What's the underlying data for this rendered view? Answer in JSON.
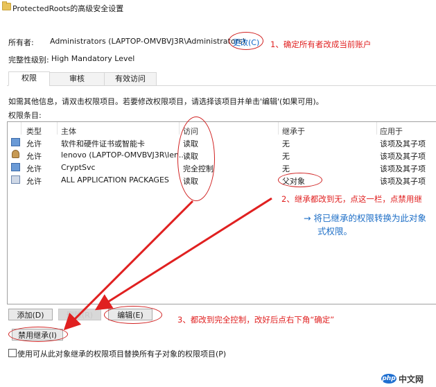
{
  "window": {
    "title": "ProtectedRoots的高级安全设置"
  },
  "owner": {
    "label": "所有者:",
    "value": "Administrators (LAPTOP-OMVBVJ3R\\Administrators)",
    "change_link": "更改(C)"
  },
  "integrity": {
    "label": "完整性级别:",
    "value": "High Mandatory Level"
  },
  "tabs": [
    {
      "label": "权限"
    },
    {
      "label": "审核"
    },
    {
      "label": "有效访问"
    }
  ],
  "instruction": "如需其他信息，请双击权限项目。若要修改权限项目，请选择该项目并单击'编辑'(如果可用)。",
  "entries_label": "权限条目:",
  "columns": {
    "type": "类型",
    "principal": "主体",
    "access": "访问",
    "inherited": "继承于",
    "applies": "应用于"
  },
  "rows": [
    {
      "icon": "security-group-icon",
      "type": "允许",
      "principal": "软件和硬件证书或智能卡",
      "access": "读取",
      "inherited": "无",
      "applies": "该项及其子项"
    },
    {
      "icon": "user-icon",
      "type": "允许",
      "principal": "lenovo (LAPTOP-OMVBVJ3R\\len...",
      "access": "读取",
      "inherited": "无",
      "applies": "该项及其子项"
    },
    {
      "icon": "service-icon",
      "type": "允许",
      "principal": "CryptSvc",
      "access": "完全控制",
      "inherited": "无",
      "applies": "该项及其子项"
    },
    {
      "icon": "app-package-icon",
      "type": "允许",
      "principal": "ALL APPLICATION PACKAGES",
      "access": "读取",
      "inherited": "父对象",
      "applies": "该项及其子项"
    }
  ],
  "buttons": {
    "add": "添加(D)",
    "remove": "删除(R)",
    "edit": "编辑(E)",
    "disable_inheritance": "禁用继承(I)"
  },
  "checkbox": {
    "label": "使用可从此对象继承的权限项目替换所有子对象的权限项目(P)",
    "checked": false
  },
  "annotations": {
    "a1": "1、确定所有者改成当前账户",
    "a2": "2、继承都改到无，点这一栏，点禁用继",
    "hint1": "→ 将已继承的权限转换为此对象",
    "hint2": "式权限。",
    "a3": "3、都改到完全控制，改好后点右下角“确定”"
  },
  "watermark": {
    "badge": "php",
    "text": "中文网"
  },
  "colors": {
    "annotation_red": "#e02020",
    "hint_blue": "#1e6fc7",
    "link_blue": "#0b63c5"
  }
}
